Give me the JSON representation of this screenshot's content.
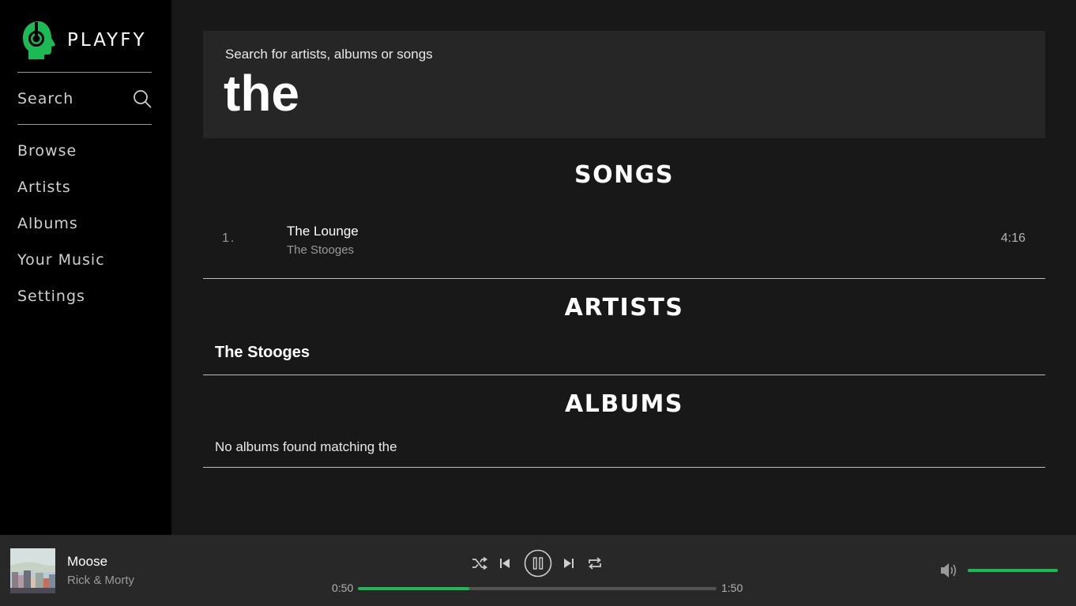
{
  "brand": {
    "name": "PLAYFY",
    "accent": "#1db954"
  },
  "sidebar": {
    "search_label": "Search",
    "items": [
      {
        "label": "Browse"
      },
      {
        "label": "Artists"
      },
      {
        "label": "Albums"
      },
      {
        "label": "Your Music"
      },
      {
        "label": "Settings"
      }
    ]
  },
  "search": {
    "hint": "Search for artists, albums or songs",
    "query": "the"
  },
  "results": {
    "songs_title": "SONGS",
    "songs": [
      {
        "number": "1.",
        "title": "The Lounge",
        "artist": "The Stooges",
        "duration": "4:16"
      }
    ],
    "artists_title": "ARTISTS",
    "artists": [
      {
        "name": "The Stooges"
      }
    ],
    "albums_title": "ALBUMS",
    "albums_empty": "No albums found matching the"
  },
  "player": {
    "now_playing": {
      "title": "Moose",
      "artist": "Rick & Morty"
    },
    "elapsed": "0:50",
    "total": "1:50",
    "progress_fraction": 0.31,
    "volume_fraction": 1.0,
    "controls": [
      "shuffle-icon",
      "previous-icon",
      "pause-icon",
      "next-icon",
      "repeat-icon"
    ]
  }
}
